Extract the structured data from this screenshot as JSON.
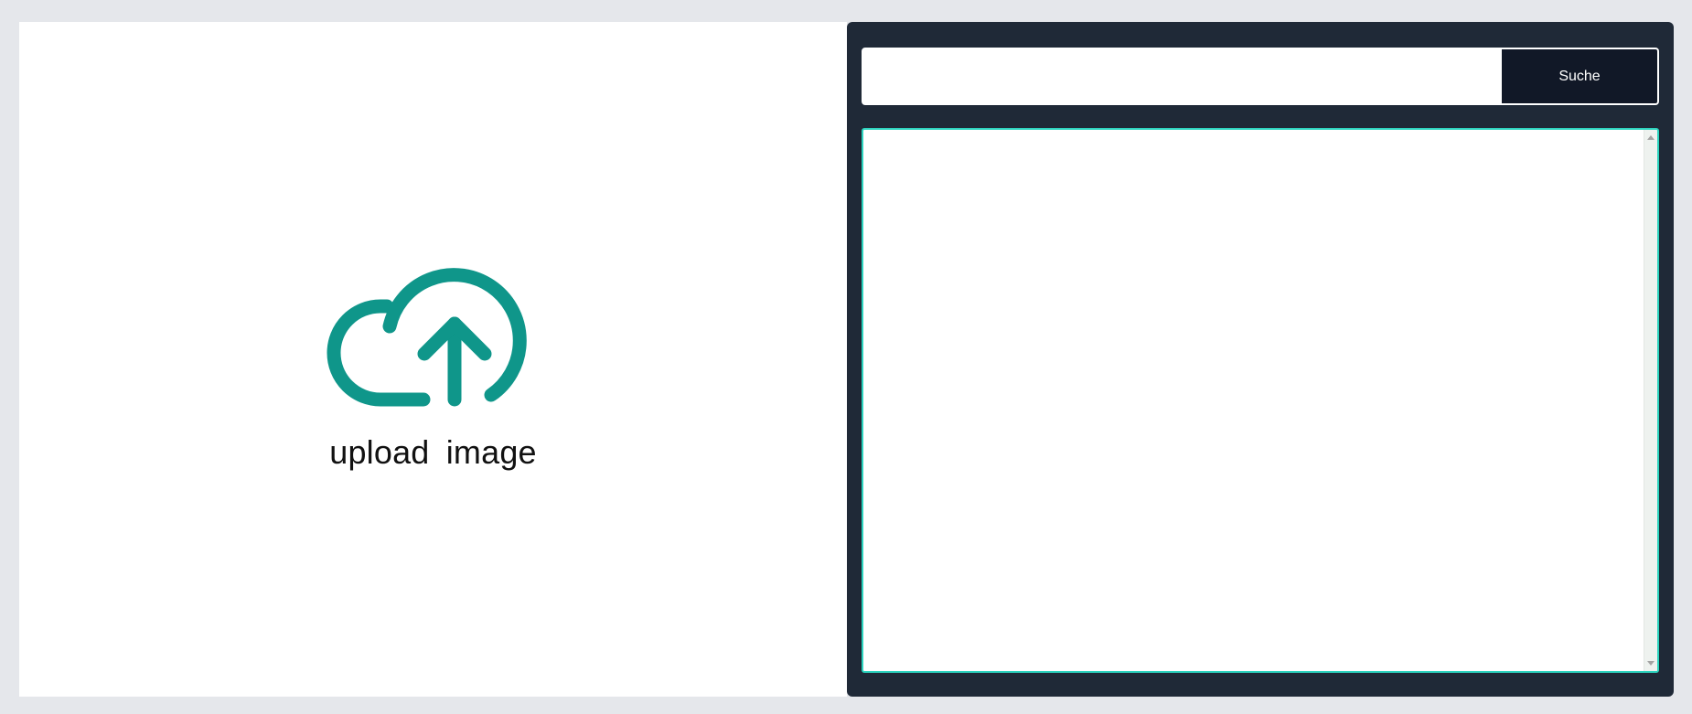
{
  "upload": {
    "label": "upload  image",
    "icon": "cloud-upload-icon",
    "icon_color": "#0f968a"
  },
  "search": {
    "input_value": "",
    "button_label": "Suche"
  },
  "results": {
    "content": ""
  },
  "colors": {
    "page_background": "#e5e7eb",
    "panel_dark": "#1f2937",
    "button_dark": "#111827",
    "results_border": "#2dd4bf"
  }
}
